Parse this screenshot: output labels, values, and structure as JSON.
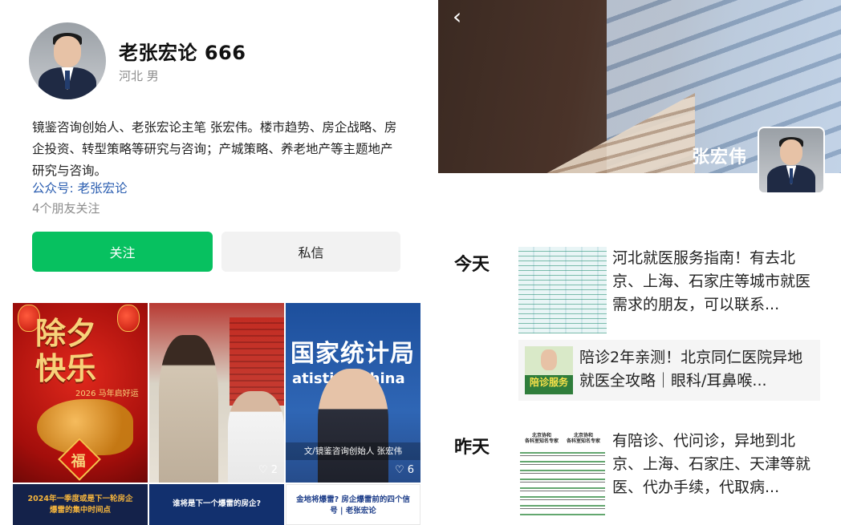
{
  "profile": {
    "name": "老张宏论 666",
    "meta": "河北 男",
    "bio": "镜鉴咨询创始人、老张宏论主笔 张宏伟。楼市趋势、房企战略、房企投资、转型策略等研究与咨询；产城策略、养老地产等主题地产研究与咨询。",
    "official_account": "公众号: 老张宏论",
    "friends": "4个朋友关注",
    "follow_label": "关注",
    "message_label": "私信"
  },
  "grid": {
    "tile1": {
      "title": "除夕\n快乐",
      "year": "2026 马年启好运"
    },
    "tile2_likes": "♡ 2",
    "tile3": {
      "sign": "国家统计局",
      "sign2": "atistic   f China",
      "caption": "文/镜鉴咨询创始人 张宏伟",
      "likes": "♡ 6"
    },
    "bottom1": "2024年一季度或是下一轮房企\n爆雷的集中时间点",
    "bottom2": "谁将是下一个爆雷的房企?",
    "bottom3": "金地将爆雷? 房企爆雷前的四个信\n号 | 老张宏论"
  },
  "right": {
    "back_icon": "‹",
    "cover_name": "张宏伟",
    "today_label": "今天",
    "yesterday_label": "昨天",
    "post1": "河北就医服务指南！有去北京、上海、石家庄等城市就医需求的朋友，可以联系...",
    "post2": "陪诊2年亲测！北京同仁医院异地就医全攻略｜眼科/耳鼻喉...",
    "post2_badge": "陪诊服务",
    "post3": "有陪诊、代问诊，异地到北京、上海、石家庄、天津等就医、代办手续，代取病...",
    "post3_thumb_left": "北京协和\n各科室知名专家",
    "post3_thumb_right": "北京协和\n各科室知名专家"
  },
  "colors": {
    "follow_green": "#07c160",
    "link_blue": "#2a5db0",
    "muted_gray": "#8c8c8c"
  }
}
